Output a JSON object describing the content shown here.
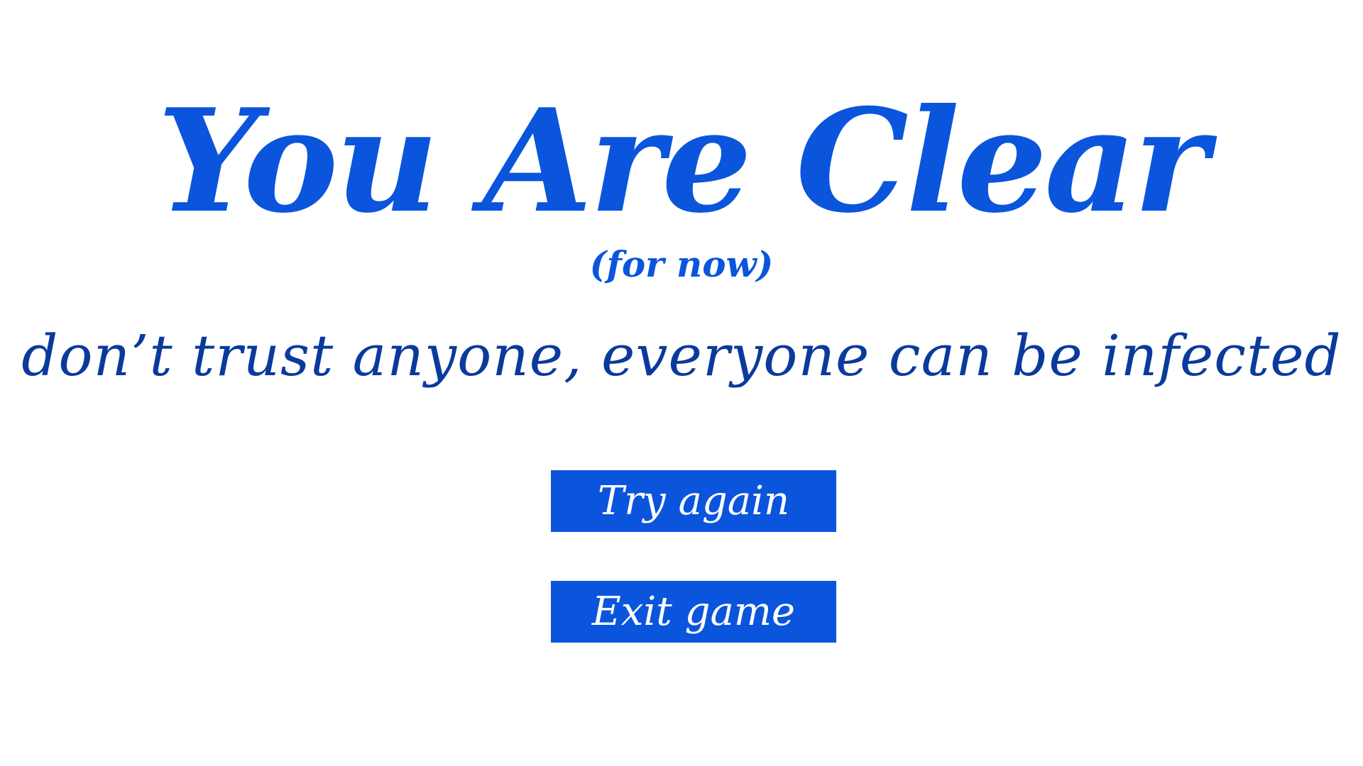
{
  "screen": {
    "title": "You Are Clear",
    "subtitle": "(for now)",
    "tagline": "don’t trust anyone, everyone can be infected"
  },
  "buttons": {
    "try_again": "Try again",
    "exit_game": "Exit game"
  },
  "colors": {
    "accent": "#0b55dd",
    "tagline": "#0a3a9c",
    "background": "#ffffff",
    "button_text": "#ffffff"
  }
}
